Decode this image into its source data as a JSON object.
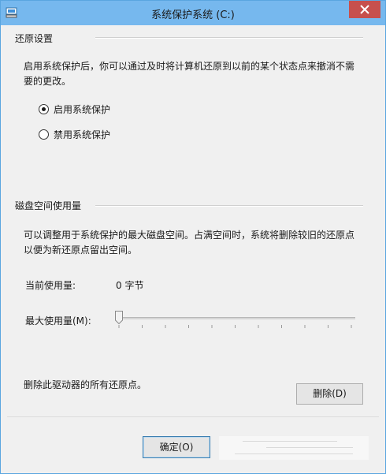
{
  "window": {
    "title": "系统保护系统 (C:)"
  },
  "restore": {
    "group_title": "还原设置",
    "description": "启用系统保护后，你可以通过及时将计算机还原到以前的某个状态点来撤消不需要的更改。",
    "options": [
      {
        "label": "启用系统保护",
        "checked": true
      },
      {
        "label": "禁用系统保护",
        "checked": false
      }
    ]
  },
  "disk": {
    "group_title": "磁盘空间使用量",
    "description": "可以调整用于系统保护的最大磁盘空间。占满空间时，系统将删除较旧的还原点以便为新还原点留出空间。",
    "current_label": "当前使用量:",
    "current_value": "0 字节",
    "max_label": "最大使用量(M):",
    "max_fraction": 0
  },
  "delete": {
    "description": "删除此驱动器的所有还原点。",
    "button_label": "删除(D)"
  },
  "footer": {
    "ok_label": "确定(O)"
  },
  "colors": {
    "titlebar": "#76b8ee",
    "close_button": "#c7504d",
    "window_border": "#5aa5e0",
    "default_button_border": "#3c7fb1"
  },
  "icons": {
    "app": "system-drive-icon",
    "close": "close-icon",
    "slider": "slider-thumb"
  }
}
